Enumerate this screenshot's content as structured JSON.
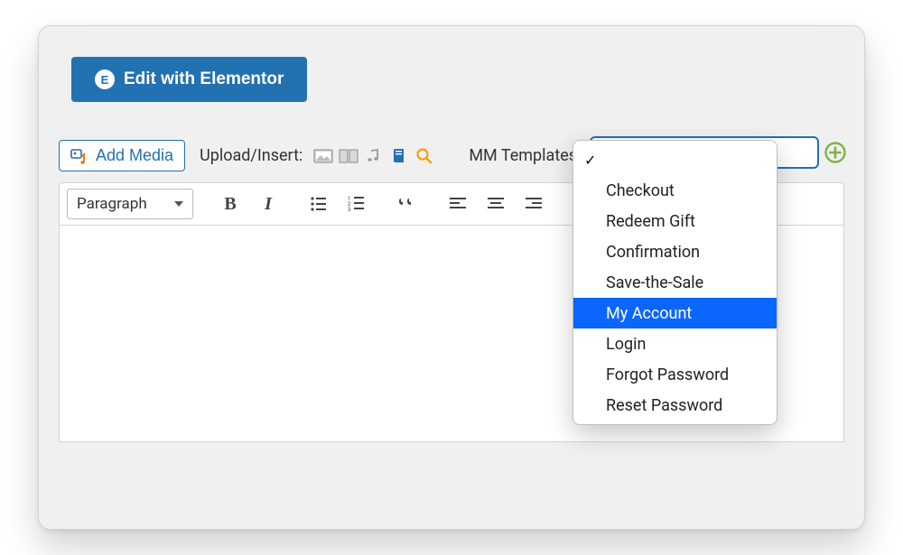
{
  "elementor": {
    "button_label": "Edit with Elementor",
    "icon_glyph": "E"
  },
  "toolbar": {
    "add_media_label": "Add Media",
    "upload_insert_label": "Upload/Insert:",
    "mm_templates_label": "MM Templates"
  },
  "editor": {
    "format_select": "Paragraph",
    "bold_glyph": "B",
    "italic_glyph": "I"
  },
  "dropdown": {
    "items": [
      {
        "label": ""
      },
      {
        "label": "Checkout"
      },
      {
        "label": "Redeem Gift"
      },
      {
        "label": "Confirmation"
      },
      {
        "label": "Save-the-Sale"
      },
      {
        "label": "My Account"
      },
      {
        "label": "Login"
      },
      {
        "label": "Forgot Password"
      },
      {
        "label": "Reset Password"
      }
    ],
    "selected_index": 0,
    "highlighted_index": 5
  }
}
